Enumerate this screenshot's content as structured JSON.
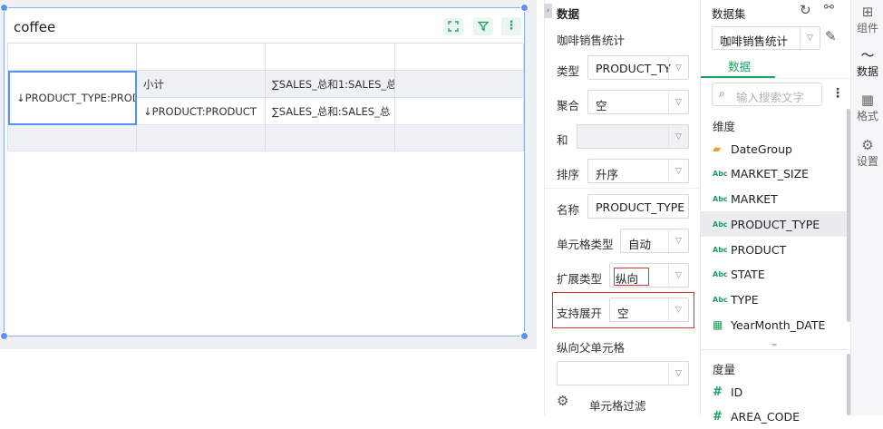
{
  "widget": {
    "title": "coffee",
    "cells": {
      "row_field": "↓PRODUCT_TYPE:PROD",
      "subtotal": "小计",
      "sum1": "∑SALES_总和1:SALES_总",
      "product": "↓PRODUCT:PRODUCT",
      "sum2": "∑SALES_总和:SALES_总"
    }
  },
  "config": {
    "header": "数据",
    "dataset_name": "咖啡销售统计",
    "type_label": "类型",
    "type_value": "PRODUCT_TY",
    "aggregate_label": "聚合",
    "aggregate_value": "空",
    "and_label": "和",
    "sort_label": "排序",
    "sort_value": "升序",
    "name_label": "名称",
    "name_value": "PRODUCT_TYPE",
    "cell_type_label": "单元格类型",
    "cell_type_value": "自动",
    "expand_type_label": "扩展类型",
    "expand_type_value": "纵向",
    "support_expand_label": "支持展开",
    "support_expand_value": "空",
    "vertical_parent_label": "纵向父单元格",
    "cell_filter_label": "单元格过滤"
  },
  "dataset": {
    "header": "数据集",
    "selected": "咖啡销售统计",
    "tab": "数据",
    "search_placeholder": "输入搜索文字",
    "dimensions_label": "维度",
    "dimensions": [
      {
        "name": "DateGroup",
        "type": "folder"
      },
      {
        "name": "MARKET_SIZE",
        "type": "Abc"
      },
      {
        "name": "MARKET",
        "type": "Abc"
      },
      {
        "name": "PRODUCT_TYPE",
        "type": "Abc"
      },
      {
        "name": "PRODUCT",
        "type": "Abc"
      },
      {
        "name": "STATE",
        "type": "Abc"
      },
      {
        "name": "TYPE",
        "type": "Abc"
      },
      {
        "name": "YearMonth_DATE",
        "type": "calendar"
      }
    ],
    "measures_label": "度量",
    "measures": [
      {
        "name": "ID",
        "type": "#"
      },
      {
        "name": "AREA_CODE",
        "type": "#"
      }
    ]
  },
  "rail": {
    "items": [
      {
        "label": "组件",
        "icon": "component-add-icon"
      },
      {
        "label": "数据",
        "icon": "data-line-icon"
      },
      {
        "label": "格式",
        "icon": "grid-format-icon"
      },
      {
        "label": "设置",
        "icon": "gear-icon"
      }
    ]
  },
  "colors": {
    "accent": "#5b8ff9",
    "green": "#1aa260",
    "highlight": "#e0302f"
  }
}
